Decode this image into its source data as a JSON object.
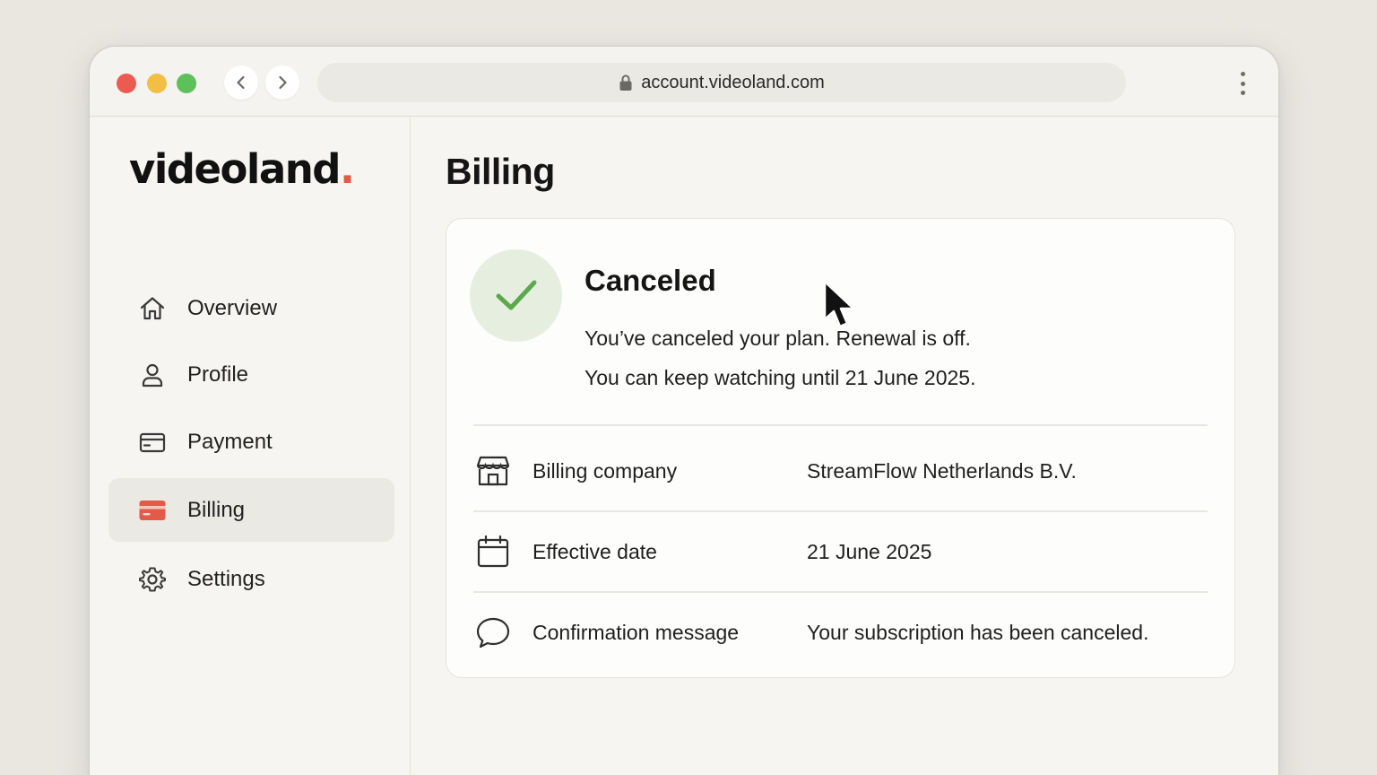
{
  "browser": {
    "url": "account.videoland.com",
    "icons": {
      "back": "chevron-left-icon",
      "forward": "chevron-right-icon",
      "lock": "lock-icon",
      "menu": "more-vertical-icon"
    },
    "traffic_lights": [
      "#ec5b52",
      "#f2bf45",
      "#5ec05a"
    ]
  },
  "sidebar": {
    "logo_text": "videoland",
    "logo_dot": ".",
    "logo_dot_color": "#e25a48",
    "items": [
      {
        "label": "Overview",
        "icon": "home-icon",
        "active": false
      },
      {
        "label": "Profile",
        "icon": "user-icon",
        "active": false
      },
      {
        "label": "Payment",
        "icon": "card-icon",
        "active": false
      },
      {
        "label": "Billing",
        "icon": "billing-card-icon",
        "active": true
      },
      {
        "label": "Settings",
        "icon": "gear-icon",
        "active": false
      }
    ]
  },
  "main": {
    "title": "Billing",
    "status": {
      "icon": "check-icon",
      "title": "Canceled",
      "line1": "You’ve canceled your plan. Renewal is off.",
      "line2": "You can keep watching until 21 June 2025."
    },
    "details": [
      {
        "icon": "store-icon",
        "label": "Billing company",
        "value": "StreamFlow Netherlands B.V."
      },
      {
        "icon": "calendar-icon",
        "label": "Effective date",
        "value": "21 June 2025"
      },
      {
        "icon": "message-icon",
        "label": "Confirmation message",
        "value": "Your subscription has been canceled."
      }
    ]
  },
  "colors": {
    "accent": "#e25a48",
    "success": "#5ba84d",
    "success_bg": "#e6efdf"
  }
}
